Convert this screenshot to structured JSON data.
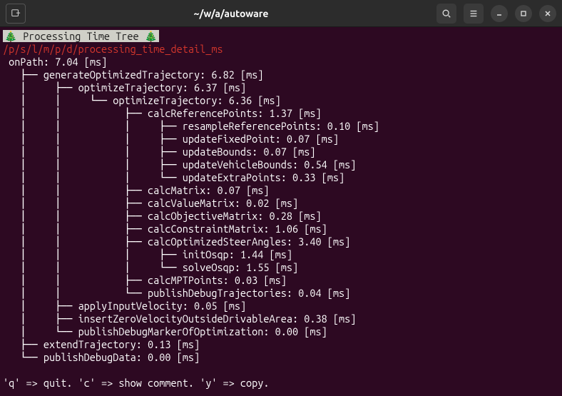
{
  "window": {
    "title": "~/w/a/autoware"
  },
  "header": {
    "prefix_emoji": "🎄",
    "text": "Processing Time Tree",
    "suffix_emoji": "🎄"
  },
  "path": "/p/s/l/m/p/d/processing_time_detail_ms",
  "root": {
    "name": "onPath",
    "value": "7.04",
    "unit": "[ms]"
  },
  "tree": {
    "l1": {
      "name": "generateOptimizedTrajectory",
      "value": "6.82",
      "unit": "[ms]"
    },
    "l2": {
      "name": "optimizeTrajectory",
      "value": "6.37",
      "unit": "[ms]"
    },
    "l3": {
      "name": "optimizeTrajectory",
      "value": "6.36",
      "unit": "[ms]"
    },
    "l4a": {
      "name": "calcReferencePoints",
      "value": "1.37",
      "unit": "[ms]"
    },
    "l5a": {
      "name": "resampleReferencePoints",
      "value": "0.10",
      "unit": "[ms]"
    },
    "l5b": {
      "name": "updateFixedPoint",
      "value": "0.07",
      "unit": "[ms]"
    },
    "l5c": {
      "name": "updateBounds",
      "value": "0.07",
      "unit": "[ms]"
    },
    "l5d": {
      "name": "updateVehicleBounds",
      "value": "0.54",
      "unit": "[ms]"
    },
    "l5e": {
      "name": "updateExtraPoints",
      "value": "0.33",
      "unit": "[ms]"
    },
    "l4b": {
      "name": "calcMatrix",
      "value": "0.07",
      "unit": "[ms]"
    },
    "l4c": {
      "name": "calcValueMatrix",
      "value": "0.02",
      "unit": "[ms]"
    },
    "l4d": {
      "name": "calcObjectiveMatrix",
      "value": "0.28",
      "unit": "[ms]"
    },
    "l4e": {
      "name": "calcConstraintMatrix",
      "value": "1.06",
      "unit": "[ms]"
    },
    "l4f": {
      "name": "calcOptimizedSteerAngles",
      "value": "3.40",
      "unit": "[ms]"
    },
    "l5f": {
      "name": "initOsqp",
      "value": "1.44",
      "unit": "[ms]"
    },
    "l5g": {
      "name": "solveOsqp",
      "value": "1.55",
      "unit": "[ms]"
    },
    "l4g": {
      "name": "calcMPTPoints",
      "value": "0.03",
      "unit": "[ms]"
    },
    "l4h": {
      "name": "publishDebugTrajectories",
      "value": "0.04",
      "unit": "[ms]"
    },
    "l2b": {
      "name": "applyInputVelocity",
      "value": "0.05",
      "unit": "[ms]"
    },
    "l2c": {
      "name": "insertZeroVelocityOutsideDrivableArea",
      "value": "0.38",
      "unit": "[ms]"
    },
    "l2d": {
      "name": "publishDebugMarkerOfOptimization",
      "value": "0.00",
      "unit": "[ms]"
    },
    "l1b": {
      "name": "extendTrajectory",
      "value": "0.13",
      "unit": "[ms]"
    },
    "l1c": {
      "name": "publishDebugData",
      "value": "0.00",
      "unit": "[ms]"
    }
  },
  "footer": "'q' => quit. 'c' => show comment. 'y' => copy."
}
